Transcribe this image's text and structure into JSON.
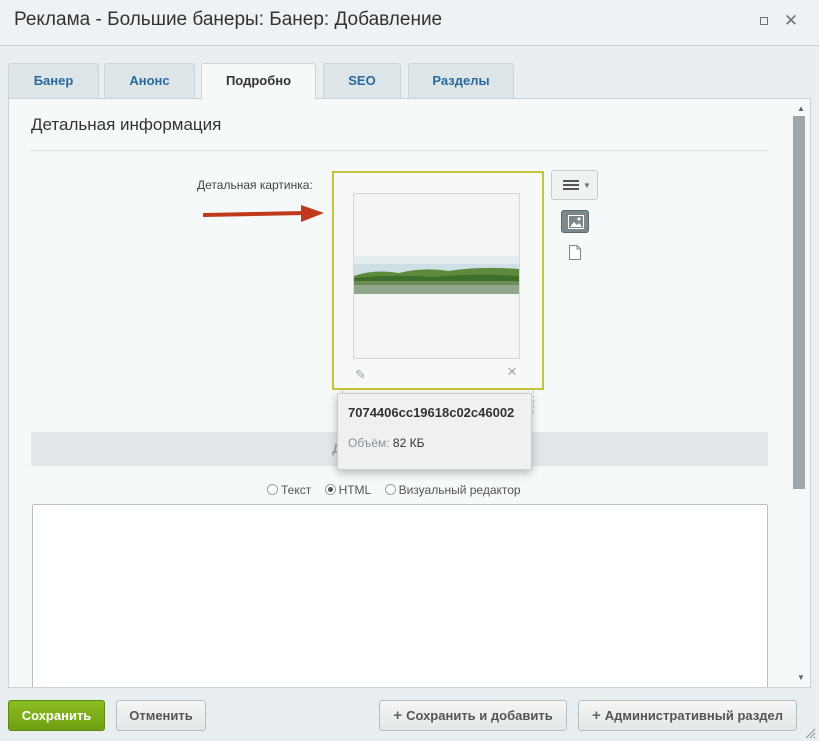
{
  "window": {
    "title": "Реклама - Большие банеры: Банер: Добавление",
    "maximize_icon": "maximize-icon",
    "close_icon": "close-icon"
  },
  "tabs": [
    {
      "label": "Банер",
      "active": false
    },
    {
      "label": "Анонс",
      "active": false
    },
    {
      "label": "Подробно",
      "active": true
    },
    {
      "label": "SEO",
      "active": false
    },
    {
      "label": "Разделы",
      "active": false
    }
  ],
  "section": {
    "title": "Детальная информация",
    "detail_image_label": "Детальная картинка:",
    "info_bar": "Детальное описание"
  },
  "image_upload": {
    "image_icon": "landscape-image",
    "edit_icon": "pencil-icon",
    "remove_icon": "close-icon",
    "menu_icon": "hamburger-menu-icon",
    "type_image_icon": "image-icon",
    "type_file_icon": "file-icon"
  },
  "tooltip": {
    "filename": "7074406cc19618c02c46002",
    "size_label": "Объём:",
    "size_value": "82 КБ"
  },
  "editor_mode": {
    "options": [
      "Текст",
      "HTML",
      "Визуальный редактор"
    ],
    "selected": "HTML"
  },
  "footer": {
    "save": "Сохранить",
    "cancel": "Отменить",
    "save_and_add": "Сохранить и добавить",
    "admin_section": "Административный раздел"
  },
  "colors": {
    "save_button": "#7aab17",
    "tab_link": "#2b6a9e",
    "highlight_frame": "#c3c43a",
    "arrow": "#c0391b"
  }
}
